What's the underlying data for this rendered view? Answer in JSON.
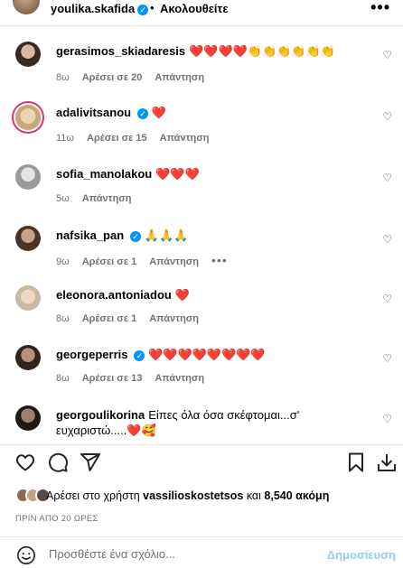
{
  "header": {
    "username": "youlika.skafida",
    "dot": "•",
    "follow_label": "Ακολουθείτε",
    "more": "•••"
  },
  "comments": [
    {
      "user": "gerasimos_skiadaresis",
      "text": "❤️❤️❤️❤️👏👏👏👏👏👏",
      "time": "8ω",
      "likes": "Αρέσει σε 20",
      "reply": "Απάντηση",
      "verified": false
    },
    {
      "user": "adalivitsanou",
      "text": "❤️",
      "time": "11ω",
      "likes": "Αρέσει σε 15",
      "reply": "Απάντηση",
      "verified": true
    },
    {
      "user": "sofia_manolakou",
      "text": "❤️❤️❤️",
      "time": "5ω",
      "likes": "",
      "reply": "Απάντηση",
      "verified": false
    },
    {
      "user": "nafsika_pan",
      "text": "🙏🙏🙏",
      "time": "9ω",
      "likes": "Αρέσει σε 1",
      "reply": "Απάντηση",
      "verified": true,
      "more": "•••"
    },
    {
      "user": "eleonora.antoniadou",
      "text": "❤️",
      "time": "8ω",
      "likes": "Αρέσει σε 1",
      "reply": "Απάντηση",
      "verified": false
    },
    {
      "user": "georgeperris",
      "text": "❤️❤️❤️❤️❤️❤️❤️❤️",
      "time": "8ω",
      "likes": "Αρέσει σε 13",
      "reply": "Απάντηση",
      "verified": true
    },
    {
      "user": "georgoulikorina",
      "text": "Είπες όλα όσα σκέφτομαι...σ' ευχαριστώ.....❤️🥰",
      "time": "",
      "likes": "",
      "reply": "",
      "verified": false
    }
  ],
  "likes": {
    "prefix": "Αρέσει στο χρήστη",
    "user": "vassilioskostetsos",
    "middle": "και",
    "count": "8,540 ακόμη"
  },
  "time_ago": "ΠΡΙΝ ΑΠΟ 20 ΩΡΕΣ",
  "add_comment": {
    "placeholder": "Προσθέστε ένα σχόλιο...",
    "post_label": "Δημοσίευση"
  },
  "colors": {
    "accent": "#0095f6",
    "muted": "#737373",
    "heart": "#ed1c24",
    "post_disabled": "#9ccaf7"
  }
}
